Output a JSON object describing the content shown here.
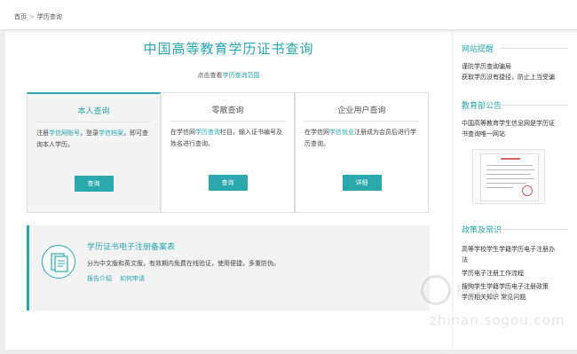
{
  "breadcrumb": {
    "home": "首页",
    "separator": ">",
    "current": "学历查询"
  },
  "main": {
    "title": "中国高等教育学历证书查询",
    "scope_prefix": "点击查看",
    "scope_link": "学历查询范围"
  },
  "cards": [
    {
      "title": "本人查询",
      "desc_parts": [
        "注册",
        "学信网账号",
        "，登录",
        "学信档案",
        "，即可查询本人学历。"
      ],
      "button": "查询"
    },
    {
      "title": "零散查询",
      "desc_parts": [
        "在学信网",
        "学历查询",
        "栏目，输入证书编号及姓名进行查询。"
      ],
      "button": "查询"
    },
    {
      "title": "企业用户查询",
      "desc_parts": [
        "在学信网",
        "学信就业",
        "注册成为会员后进行学历查询。"
      ],
      "button": "详细"
    }
  ],
  "registration": {
    "title": "学历证书电子注册备案表",
    "desc": "分为中文版和英文版，有效期内免费在线验证，使用便捷，多重防伪。",
    "link_intro": "报告介绍",
    "link_apply": "如何申请"
  },
  "sidebar": {
    "site_notice": {
      "heading": "网站提醒",
      "items": [
        "谨防学历查询骗局",
        "获取学历没有捷径，防止上当受骗"
      ]
    },
    "ministry": {
      "heading": "教育部公告",
      "items": [
        "中国高等教育学生信息网是学历证",
        "书查询唯一网站"
      ]
    },
    "policy": {
      "heading": "政策及常识",
      "items": [
        "高等学校学生学籍学历电子注册办",
        "法",
        "学历电子注册工作流程",
        "搜狗学生学籍学历电子注册政策",
        "学历相关知识",
        "常见问题"
      ]
    }
  },
  "watermark": {
    "cn": "搜狗指南",
    "en": "zhinan.sogou.com"
  },
  "colors": {
    "accent": "#28a6ad",
    "button": "#2aa8ad"
  },
  "icons": {
    "document": "document-icon",
    "notice_image": "notice-document-image"
  }
}
